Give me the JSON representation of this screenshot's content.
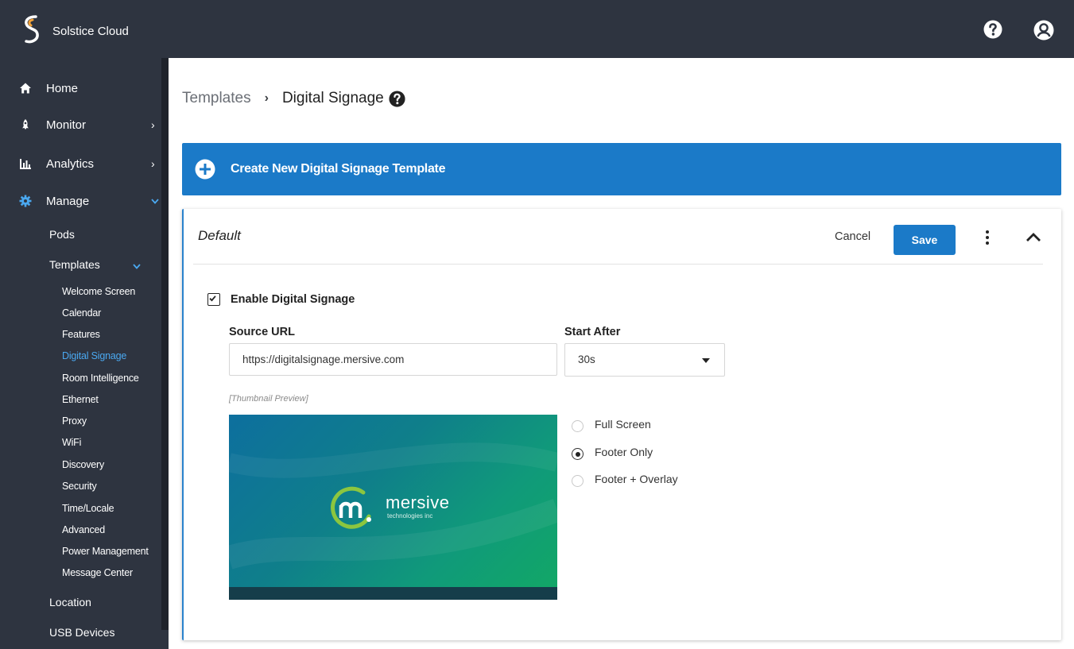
{
  "app": {
    "name": "Solstice Cloud"
  },
  "sidebar": {
    "main_items": [
      {
        "label": "Home"
      },
      {
        "label": "Monitor"
      },
      {
        "label": "Analytics"
      },
      {
        "label": "Manage"
      }
    ],
    "manage_items": [
      {
        "label": "Pods"
      },
      {
        "label": "Templates"
      }
    ],
    "template_items": [
      {
        "label": "Welcome Screen"
      },
      {
        "label": "Calendar"
      },
      {
        "label": "Features"
      },
      {
        "label": "Digital Signage"
      },
      {
        "label": "Room Intelligence"
      },
      {
        "label": "Ethernet"
      },
      {
        "label": "Proxy"
      },
      {
        "label": "WiFi"
      },
      {
        "label": "Discovery"
      },
      {
        "label": "Security"
      },
      {
        "label": "Time/Locale"
      },
      {
        "label": "Advanced"
      },
      {
        "label": "Power Management"
      },
      {
        "label": "Message Center"
      }
    ],
    "bottom_items": [
      {
        "label": "Location"
      },
      {
        "label": "USB Devices"
      }
    ],
    "active_item": "Digital Signage"
  },
  "breadcrumb": {
    "parent": "Templates",
    "current": "Digital Signage"
  },
  "create_bar": {
    "label": "Create New Digital Signage Template"
  },
  "card": {
    "title": "Default",
    "cancel_label": "Cancel",
    "save_label": "Save",
    "enable_label": "Enable Digital Signage",
    "enabled": true,
    "source_url_label": "Source URL",
    "source_url_value": "https://digitalsignage.mersive.com",
    "start_after_label": "Start After",
    "start_after_value": "30s",
    "thumbnail_caption": "[Thumbnail Preview]",
    "thumbnail_brand": "mersive",
    "thumbnail_brand_sub": "technologies inc",
    "display_modes": [
      {
        "label": "Full Screen",
        "selected": false
      },
      {
        "label": "Footer Only",
        "selected": true
      },
      {
        "label": "Footer + Overlay",
        "selected": false
      }
    ]
  },
  "colors": {
    "header_bg": "#2e3440",
    "accent_blue": "#1b7ac8",
    "active_link": "#4aa8f0"
  }
}
